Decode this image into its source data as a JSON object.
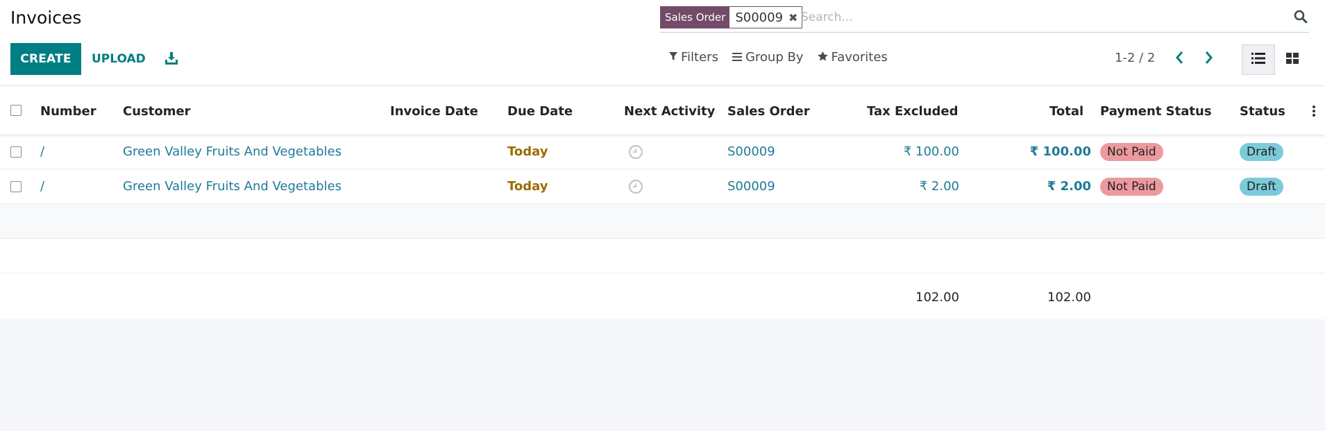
{
  "page": {
    "title": "Invoices"
  },
  "toolbar": {
    "create_label": "CREATE",
    "upload_label": "UPLOAD",
    "download_icon": "download-icon"
  },
  "search": {
    "facet_label": "Sales Order",
    "facet_value": "S00009",
    "placeholder": "Search..."
  },
  "menus": {
    "filters": "Filters",
    "group_by": "Group By",
    "favorites": "Favorites"
  },
  "pager": {
    "value": "1-2 / 2"
  },
  "table": {
    "headers": {
      "number": "Number",
      "customer": "Customer",
      "invoice_date": "Invoice Date",
      "due_date": "Due Date",
      "next_activity": "Next Activity",
      "sales_order": "Sales Order",
      "tax_excluded": "Tax Excluded",
      "total": "Total",
      "payment_status": "Payment Status",
      "status": "Status"
    },
    "rows": [
      {
        "number": "/",
        "customer": "Green Valley Fruits And Vegetables",
        "invoice_date": "",
        "due_date": "Today",
        "sales_order": "S00009",
        "tax_excluded": "₹ 100.00",
        "total": "₹ 100.00",
        "payment_status": "Not Paid",
        "status": "Draft"
      },
      {
        "number": "/",
        "customer": "Green Valley Fruits And Vegetables",
        "invoice_date": "",
        "due_date": "Today",
        "sales_order": "S00009",
        "tax_excluded": "₹ 2.00",
        "total": "₹ 2.00",
        "payment_status": "Not Paid",
        "status": "Draft"
      }
    ],
    "footer": {
      "tax_excluded": "102.00",
      "total": "102.00"
    }
  },
  "colors": {
    "primary": "#017e84",
    "facet": "#714b67",
    "link": "#1f7a99",
    "today": "#9b6b00",
    "not_paid": "#ec9a9f",
    "draft": "#7ccbd9"
  }
}
